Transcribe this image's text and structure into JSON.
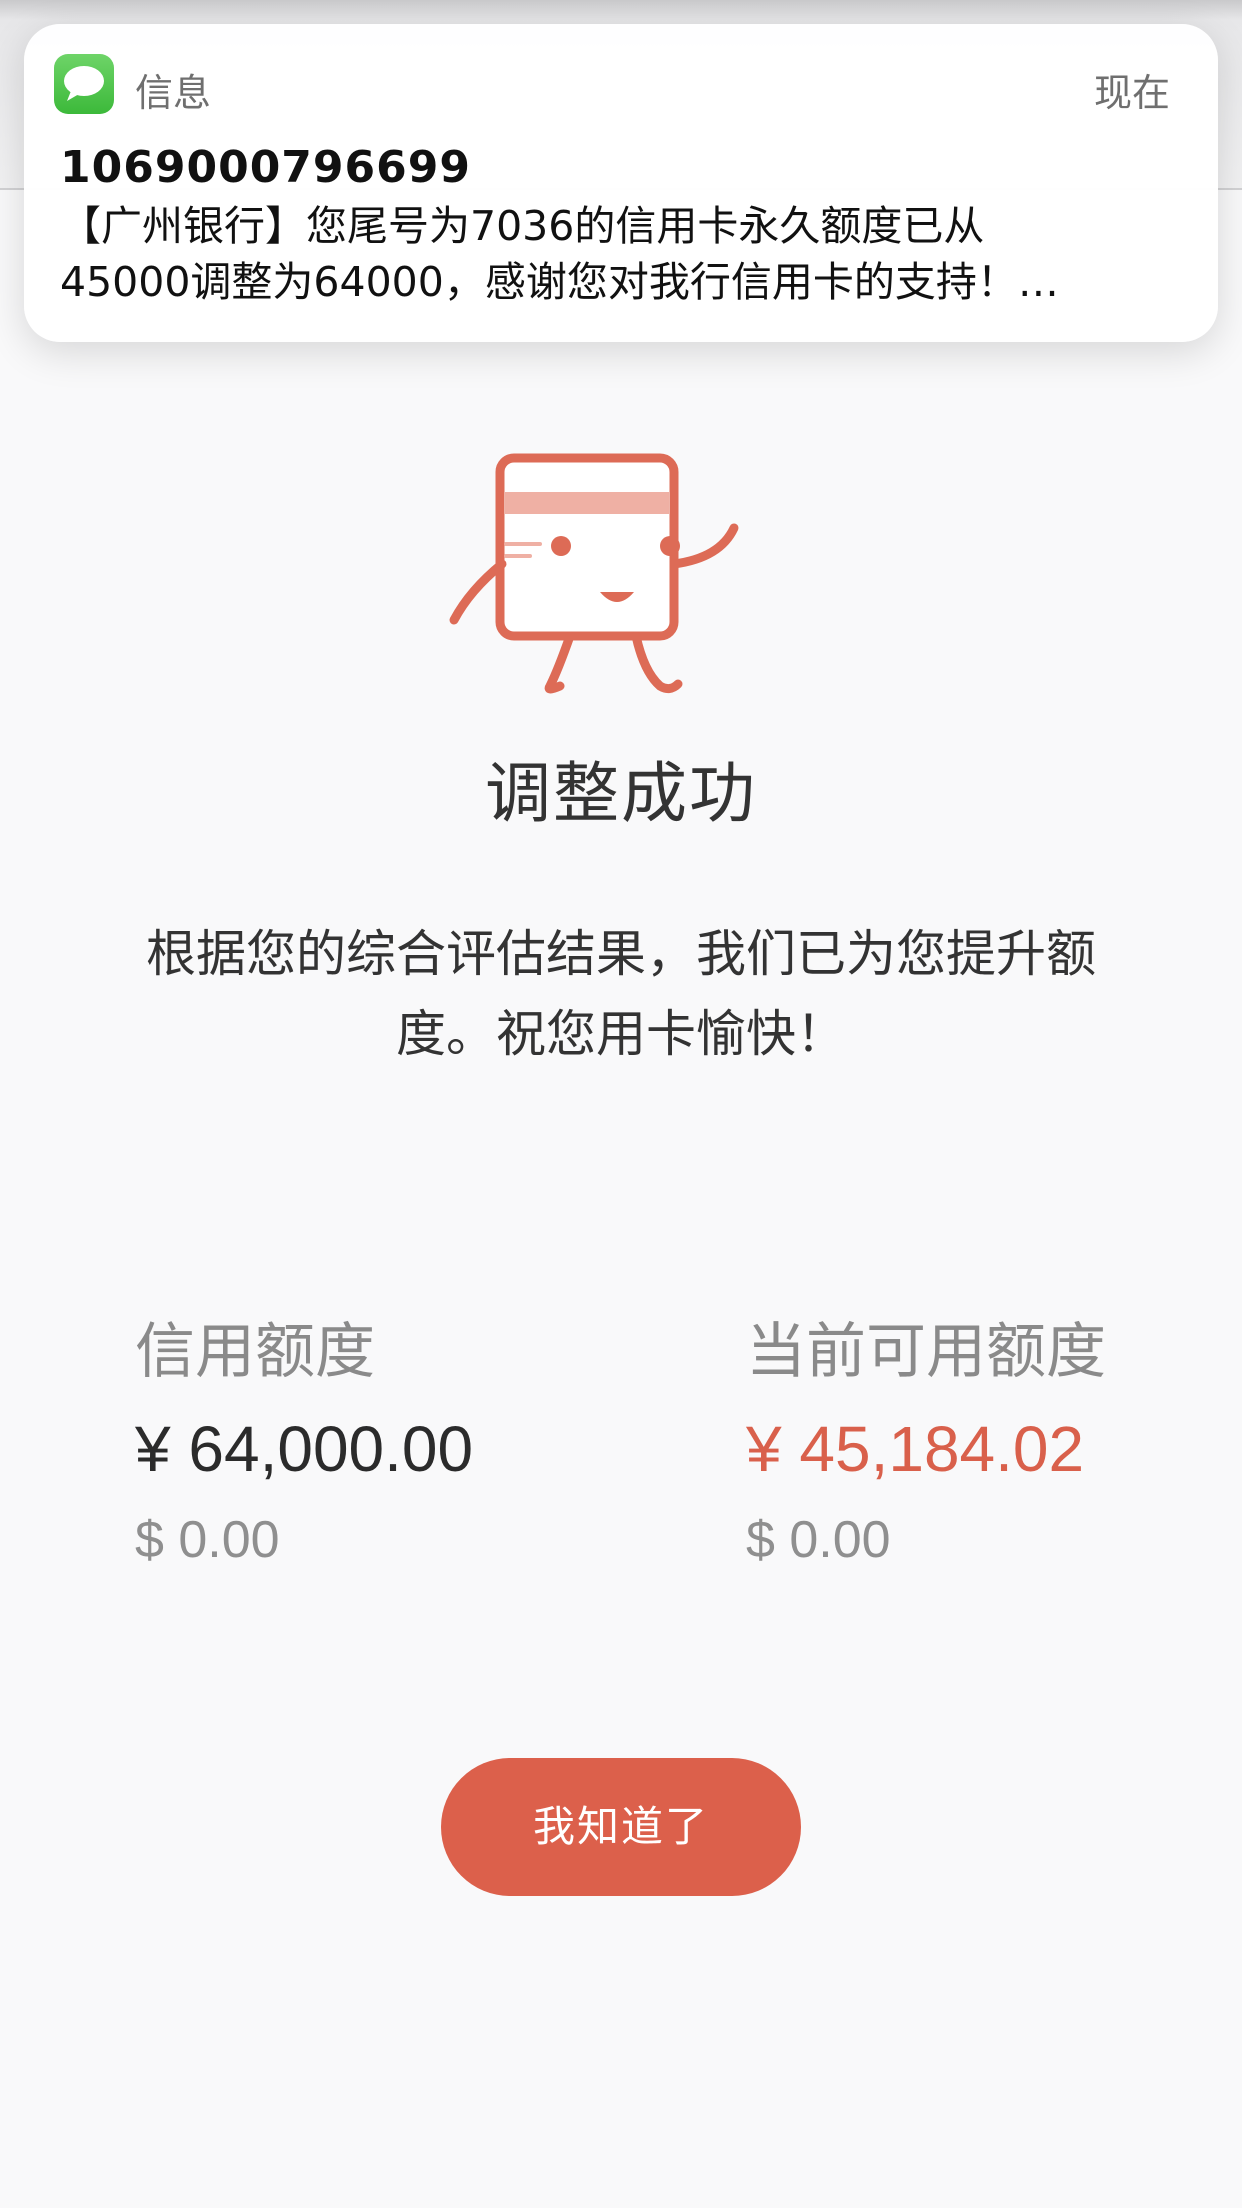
{
  "notification": {
    "app_name": "信息",
    "time": "现在",
    "sender": "1069000796699",
    "body": "【广州银行】您尾号为7036的信用卡永久额度已从\n45000调整为64000，感谢您对我行信用卡的支持！…",
    "app_icon": "messages-icon"
  },
  "result": {
    "title": "调整成功",
    "description": "根据您的综合评估结果，我们已为您提升额度。祝您用卡愉快！",
    "illustration": "credit-card-mascot-icon"
  },
  "limits": {
    "credit_limit_label": "信用额度",
    "credit_limit_cny": "¥ 64,000.00",
    "credit_limit_usd": "$ 0.00",
    "available_limit_label": "当前可用额度",
    "available_limit_cny": "¥ 45,184.02",
    "available_limit_usd": "$ 0.00"
  },
  "actions": {
    "confirm_label": "我知道了"
  },
  "colors": {
    "accent": "#dc604b",
    "background": "#f9f9fa"
  }
}
